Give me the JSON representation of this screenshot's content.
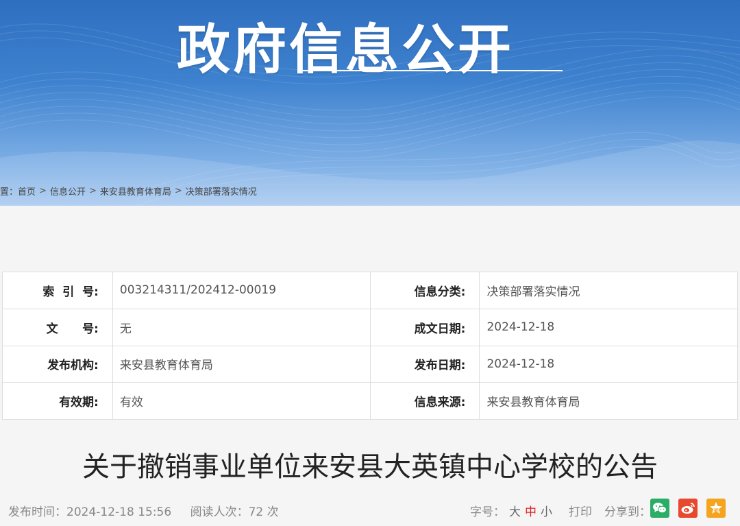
{
  "banner": {
    "title": "政府信息公开"
  },
  "breadcrumb": {
    "prefix": "位置：",
    "items": [
      "首页",
      "信息公开",
      "来安县教育体育局",
      "决策部署落实情况"
    ],
    "separator": ">"
  },
  "meta": {
    "rows": [
      {
        "l1": "索  引  号:",
        "v1": "003214311/202412-00019",
        "l2": "信息分类:",
        "v2": "决策部署落实情况"
      },
      {
        "l1": "文      号:",
        "v1": "无",
        "l2": "成文日期:",
        "v2": "2024-12-18"
      },
      {
        "l1": "发布机构:",
        "v1": "来安县教育体育局",
        "l2": "发布日期:",
        "v2": "2024-12-18"
      },
      {
        "l1": "有效期:",
        "v1": "有效",
        "l2": "信息来源:",
        "v2": "来安县教育体育局"
      }
    ]
  },
  "article": {
    "title": "关于撤销事业单位来安县大英镇中心学校的公告",
    "publish_time": "发布时间：2024-12-18 15:56",
    "read_count": "阅读人次：72 次",
    "font_size_label": "字号：",
    "font_large": "大",
    "font_medium": "中",
    "font_small": "小",
    "print_label": "打印",
    "share_label": "分享到："
  },
  "colors": {
    "banner": "#3e82cf",
    "wechat": "#2aae67",
    "weibo": "#e6492e",
    "qzone": "#f4a41f",
    "active_font": "#e02020"
  },
  "icons": [
    "wechat-icon",
    "weibo-icon",
    "qzone-icon"
  ]
}
